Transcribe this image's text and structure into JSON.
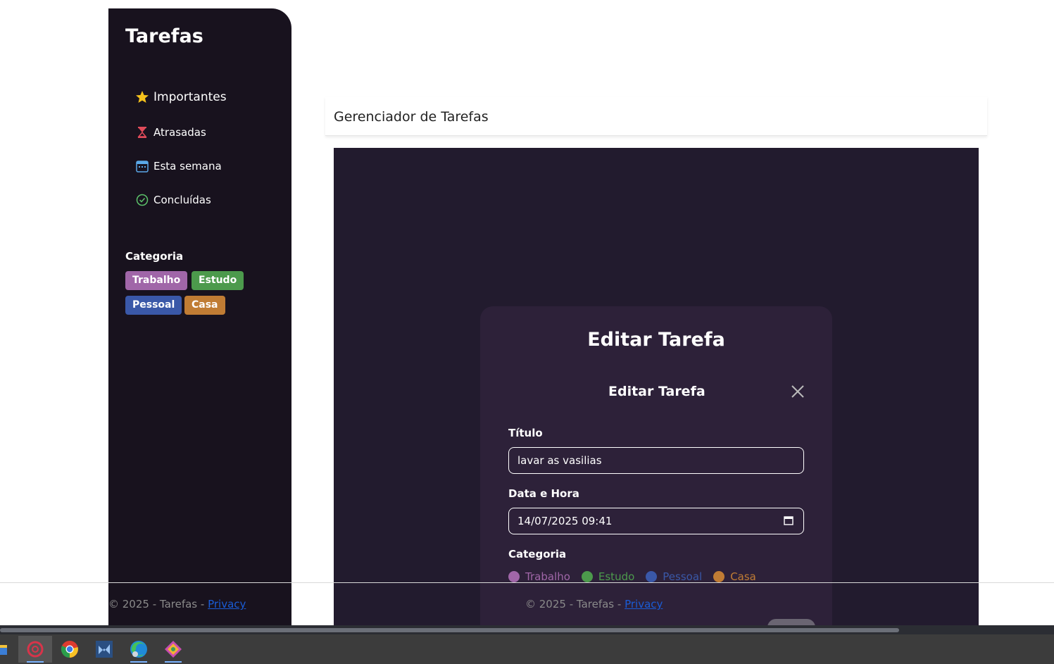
{
  "sidebar": {
    "brand": "Tarefas",
    "nav": [
      {
        "label": "Importantes",
        "icon": "star-icon"
      },
      {
        "label": "Atrasadas",
        "icon": "hourglass-icon"
      },
      {
        "label": "Esta semana",
        "icon": "calendar-icon"
      },
      {
        "label": "Concluídas",
        "icon": "check-circle-icon"
      }
    ],
    "category_title": "Categoria",
    "categories": [
      {
        "label": "Trabalho",
        "color": "#a066a8"
      },
      {
        "label": "Estudo",
        "color": "#4c9a4c"
      },
      {
        "label": "Pessoal",
        "color": "#3a58a8"
      },
      {
        "label": "Casa",
        "color": "#c07c34"
      }
    ]
  },
  "header": {
    "title": "Gerenciador de Tarefas"
  },
  "modal": {
    "heading": "Editar Tarefa",
    "subheading": "Editar Tarefa",
    "title_label": "Título",
    "title_value": "lavar as vasilias",
    "datetime_label": "Data e Hora",
    "datetime_value": "14/07/2025 09:41",
    "category_label": "Categoria",
    "category_options": [
      {
        "label": "Trabalho",
        "color": "#a066a8"
      },
      {
        "label": "Estudo",
        "color": "#4c9a4c"
      },
      {
        "label": "Pessoal",
        "color": "#3a58a8"
      },
      {
        "label": "Casa",
        "color": "#c07c34"
      }
    ]
  },
  "footer": {
    "text": "© 2025 - Tarefas - ",
    "link": "Privacy"
  },
  "taskbar": {
    "apps": [
      "file-explorer-icon",
      "app-red-icon",
      "chrome-icon",
      "visual-studio-icon",
      "edge-icon",
      "git-icon"
    ]
  }
}
